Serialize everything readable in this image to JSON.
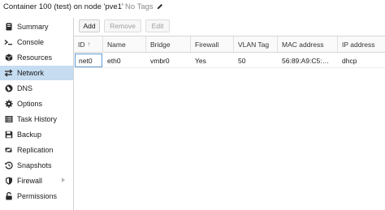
{
  "header": {
    "title": "Container 100 (test) on node 'pve1'",
    "tags_label": "No Tags",
    "edit_icon": "pencil-icon"
  },
  "sidebar": {
    "items": [
      {
        "label": "Summary",
        "icon": "book-icon",
        "active": false
      },
      {
        "label": "Console",
        "icon": "terminal-icon",
        "active": false
      },
      {
        "label": "Resources",
        "icon": "cube-icon",
        "active": false
      },
      {
        "label": "Network",
        "icon": "exchange-arrows-icon",
        "active": true
      },
      {
        "label": "DNS",
        "icon": "globe-icon",
        "active": false
      },
      {
        "label": "Options",
        "icon": "gear-icon",
        "active": false
      },
      {
        "label": "Task History",
        "icon": "list-icon",
        "active": false
      },
      {
        "label": "Backup",
        "icon": "floppy-icon",
        "active": false
      },
      {
        "label": "Replication",
        "icon": "retweet-icon",
        "active": false
      },
      {
        "label": "Snapshots",
        "icon": "history-icon",
        "active": false
      },
      {
        "label": "Firewall",
        "icon": "shield-icon",
        "active": false,
        "expandable": true
      },
      {
        "label": "Permissions",
        "icon": "unlock-icon",
        "active": false
      }
    ]
  },
  "toolbar": {
    "add_label": "Add",
    "remove_label": "Remove",
    "edit_label": "Edit"
  },
  "grid": {
    "columns": [
      "ID",
      "Name",
      "Bridge",
      "Firewall",
      "VLAN Tag",
      "MAC address",
      "IP address"
    ],
    "sort_indicator": "↑",
    "rows": [
      [
        "net0",
        "eth0",
        "vmbr0",
        "Yes",
        "50",
        "56:89:A9:C5:…",
        "dhcp"
      ]
    ]
  }
}
